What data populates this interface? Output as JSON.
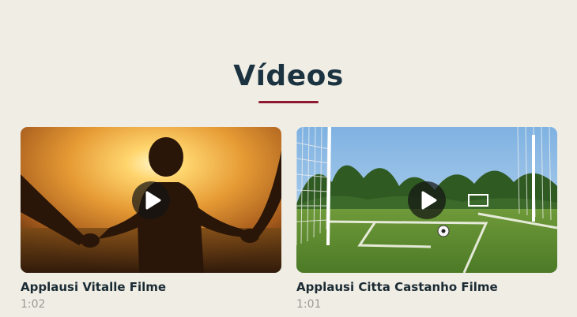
{
  "section": {
    "title": "Vídeos"
  },
  "colors": {
    "background": "#efede4",
    "title": "#1b3340",
    "accent_underline": "#8e1a32",
    "duration_text": "#9a9a94"
  },
  "videos": [
    {
      "title": "Applausi Vitalle Filme",
      "duration": "1:02",
      "thumbnail_icon": "sunset-family-thumbnail",
      "play_icon": "play-icon"
    },
    {
      "title": "Applausi Citta Castanho Filme",
      "duration": "1:01",
      "thumbnail_icon": "soccer-field-thumbnail",
      "play_icon": "play-icon"
    }
  ]
}
